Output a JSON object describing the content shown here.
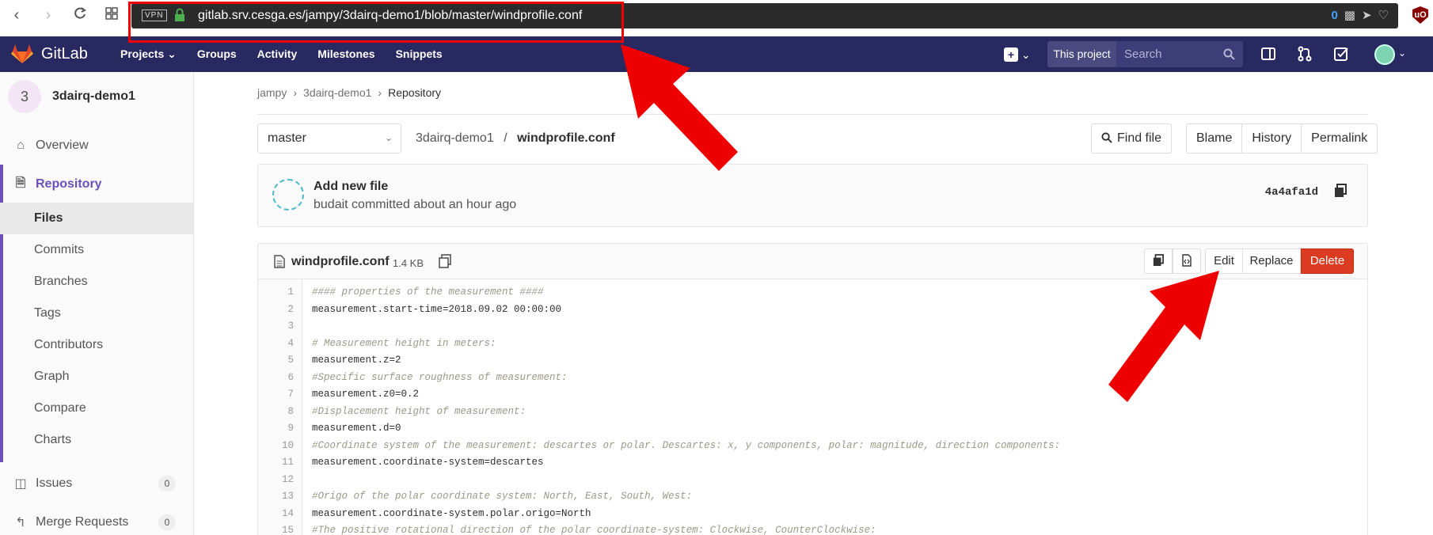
{
  "browser": {
    "vpn": "VPN",
    "url_host": "gitlab.srv.cesga.es",
    "url_path": "/jampy/3dairq-demo1/blob/master/windprofile.conf",
    "badge_count": "0"
  },
  "header": {
    "logo_text": "GitLab",
    "nav": [
      "Projects",
      "Groups",
      "Activity",
      "Milestones",
      "Snippets"
    ],
    "this_project": "This project",
    "search_placeholder": "Search"
  },
  "sidebar": {
    "project_initial": "3",
    "project_name": "3dairq-demo1",
    "overview": "Overview",
    "repository": "Repository",
    "sub_items": [
      "Files",
      "Commits",
      "Branches",
      "Tags",
      "Contributors",
      "Graph",
      "Compare",
      "Charts"
    ],
    "issues": "Issues",
    "issues_count": "0",
    "merge_requests": "Merge Requests",
    "merge_requests_count": "0"
  },
  "breadcrumb": [
    "jampy",
    "3dairq-demo1",
    "Repository"
  ],
  "toolbar": {
    "branch": "master",
    "path_project": "3dairq-demo1",
    "path_sep": "/",
    "path_file": "windprofile.conf",
    "find_file": "Find file",
    "blame": "Blame",
    "history": "History",
    "permalink": "Permalink"
  },
  "commit": {
    "title": "Add new file",
    "meta": "budait committed about an hour ago",
    "sha": "4a4afa1d"
  },
  "file": {
    "name": "windprofile.conf",
    "size": "1.4 KB",
    "edit": "Edit",
    "replace": "Replace",
    "delete": "Delete"
  },
  "code_lines": [
    {
      "n": "1",
      "t": "#### properties of the measurement ####",
      "c": true
    },
    {
      "n": "2",
      "t": "measurement.start-time=2018.09.02 00:00:00",
      "c": false
    },
    {
      "n": "3",
      "t": "",
      "c": false
    },
    {
      "n": "4",
      "t": "# Measurement height in meters:",
      "c": true
    },
    {
      "n": "5",
      "t": "measurement.z=2",
      "c": false
    },
    {
      "n": "6",
      "t": "#Specific surface roughness of measurement:",
      "c": true
    },
    {
      "n": "7",
      "t": "measurement.z0=0.2",
      "c": false
    },
    {
      "n": "8",
      "t": "#Displacement height of measurement:",
      "c": true
    },
    {
      "n": "9",
      "t": "measurement.d=0",
      "c": false
    },
    {
      "n": "10",
      "t": "#Coordinate system of the measurement: descartes or polar. Descartes: x, y components, polar: magnitude, direction components:",
      "c": true
    },
    {
      "n": "11",
      "t": "measurement.coordinate-system=descartes",
      "c": false
    },
    {
      "n": "12",
      "t": "",
      "c": false
    },
    {
      "n": "13",
      "t": "#Origo of the polar coordinate system: North, East, South, West:",
      "c": true
    },
    {
      "n": "14",
      "t": "measurement.coordinate-system.polar.origo=North",
      "c": false
    },
    {
      "n": "15",
      "t": "#The positive rotational direction of the polar coordinate-system: Clockwise, CounterClockwise:",
      "c": true
    }
  ],
  "colors": {
    "header_bg": "#292961",
    "active_accent": "#6b4fbb",
    "delete_bg": "#db3b21",
    "annotation_red": "#ee0000"
  }
}
